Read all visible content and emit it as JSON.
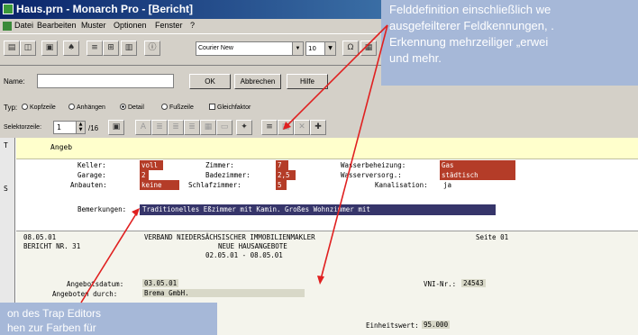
{
  "window": {
    "title": "Haus.prn - Monarch Pro - [Bericht]"
  },
  "menu": [
    "Datei",
    "Bearbeiten",
    "Muster",
    "Optionen",
    "Fenster",
    "?"
  ],
  "toolbar": {
    "font": "Courier New",
    "size": "10"
  },
  "form": {
    "name_label": "Name:",
    "ok_label": "OK",
    "cancel_label": "Abbrechen",
    "help_label": "Hilfe",
    "typ_label": "Typ:",
    "typ_options": [
      "Kopfzeile",
      "Anhängen",
      "Detail",
      "Fußzeile"
    ],
    "gleich_label": "Gleichfaktor",
    "selector_label": "Selektorzeile:",
    "selector_value": "1",
    "selector_total": "/16"
  },
  "editor": {
    "side_marks": [
      "T",
      "S"
    ],
    "band_title": "Angeb",
    "fields": [
      {
        "label": "Keller:",
        "value": "voll"
      },
      {
        "label": "Garage:",
        "value": "2"
      },
      {
        "label": "Anbauten:",
        "value": "keine"
      },
      {
        "label": "Zimmer:",
        "value": "7"
      },
      {
        "label": "Badezimmer:",
        "value": "2,5"
      },
      {
        "label": "Schlafzimmer:",
        "value": "5"
      },
      {
        "label": "Wasserbeheizung:",
        "value": "Gas"
      },
      {
        "label": "Wasserversorg.:",
        "value": "städtisch"
      },
      {
        "label": "Kanalisation:",
        "value": "ja"
      }
    ],
    "bemerkungen_label": "Bemerkungen:",
    "bemerkungen_value": "Traditionelles Eßzimmer mit Kamin. Großes Wohnzimmer mit",
    "report": {
      "date": "08.05.01",
      "org": "VERBAND NIEDERSÄCHSISCHER IMMOBILIENMAKLER",
      "page": "Seite 01",
      "report_no": "BERICHT NR. 31",
      "heading": "NEUE HAUSANGEBOTE",
      "range": "02.05.01 - 08.05.01",
      "angebotsdatum_label": "Angebotsdatum:",
      "angebotsdatum_value": "03.05.01",
      "angeboten_label": "Angeboten durch:",
      "angeboten_value": "Brema GmbH.",
      "vni_label": "VNI-Nr.:",
      "vni_value": "24543",
      "einheitswert_label": "Einheitswert:",
      "einheitswert_value": "95.000"
    }
  },
  "callouts": {
    "right": [
      "Felddefinition einschließlich we",
      "ausgefeilterer Feldkennungen, .",
      "Erkennung mehrzeiliger „erwei",
      "und mehr."
    ],
    "left": [
      "on des Trap Editors",
      "hen zur Farben für"
    ]
  },
  "colors": {
    "field_red": "#b43c28",
    "field_blue": "#36356a",
    "callout": "#a6b8d8",
    "arrow": "#e02020"
  }
}
